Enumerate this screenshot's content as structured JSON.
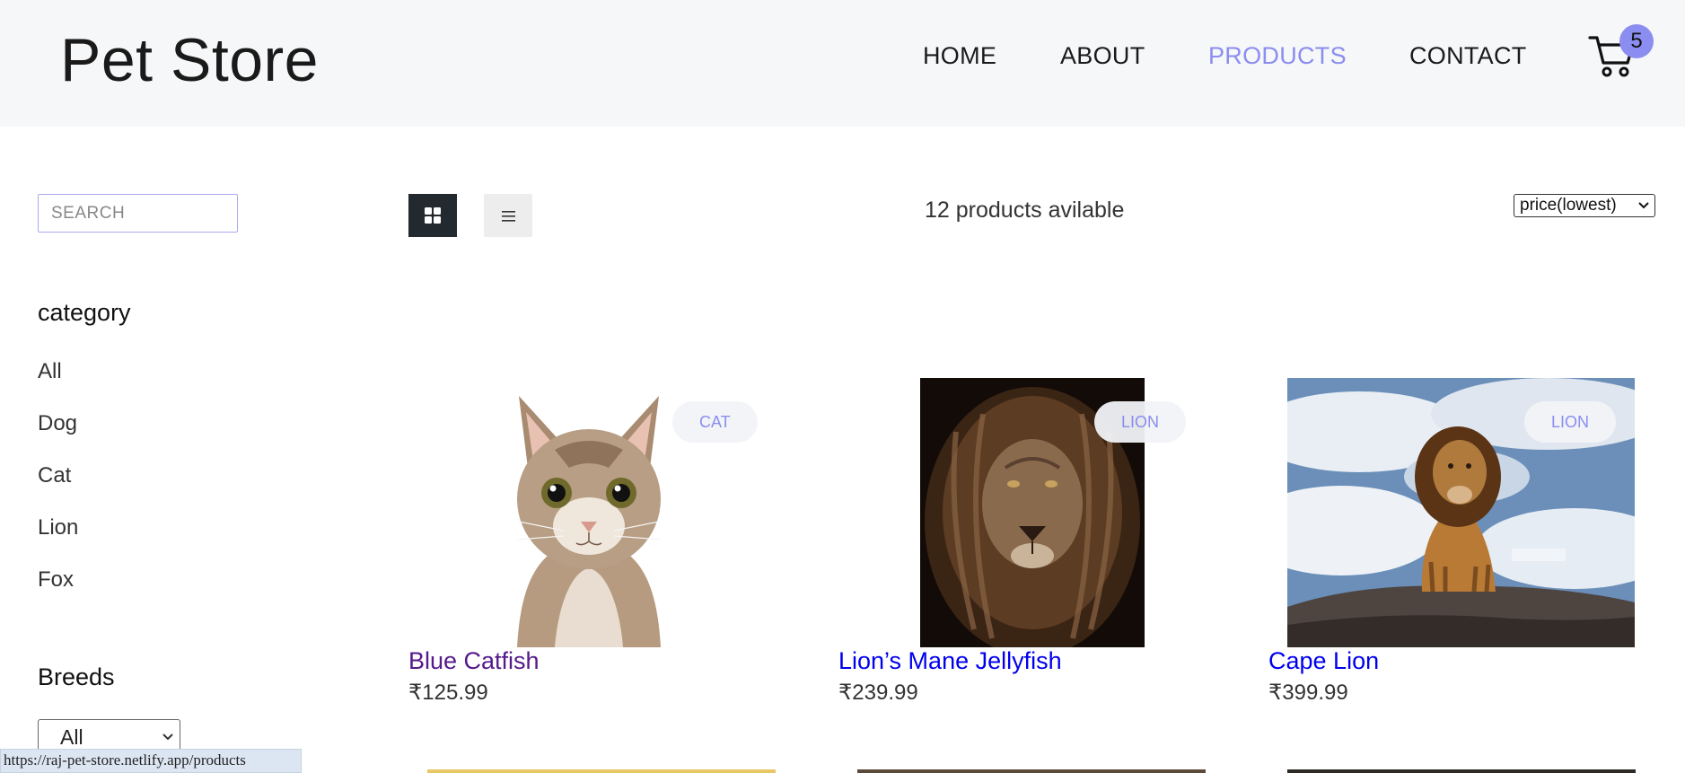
{
  "header": {
    "logo": "Pet Store",
    "nav": [
      {
        "label": "HOME"
      },
      {
        "label": "ABOUT"
      },
      {
        "label": "PRODUCTS"
      },
      {
        "label": "CONTACT"
      }
    ],
    "cart_count": "5"
  },
  "sidebar": {
    "search_placeholder": "SEARCH",
    "category_heading": "category",
    "categories": [
      "All",
      "Dog",
      "Cat",
      "Lion",
      "Fox"
    ],
    "breeds_heading": "Breeds",
    "breed_selected": "All"
  },
  "toolbar": {
    "count_text": "12 products avilable",
    "sort_selected": "price(lowest)"
  },
  "products": [
    {
      "name": "Blue Catfish",
      "price": "₹125.99",
      "tag": "CAT",
      "name_color": "#551a8b"
    },
    {
      "name": "Lion’s Mane Jellyfish",
      "price": "₹239.99",
      "tag": "LION",
      "name_color": "#0000ee"
    },
    {
      "name": "Cape Lion",
      "price": "₹399.99",
      "tag": "LION",
      "name_color": "#0000ee"
    }
  ],
  "status_url": "https://raj-pet-store.netlify.app/products",
  "colors": {
    "accent": "#8b8df0",
    "header_bg": "#f6f7f8",
    "grid_btn_bg": "#222a30"
  }
}
